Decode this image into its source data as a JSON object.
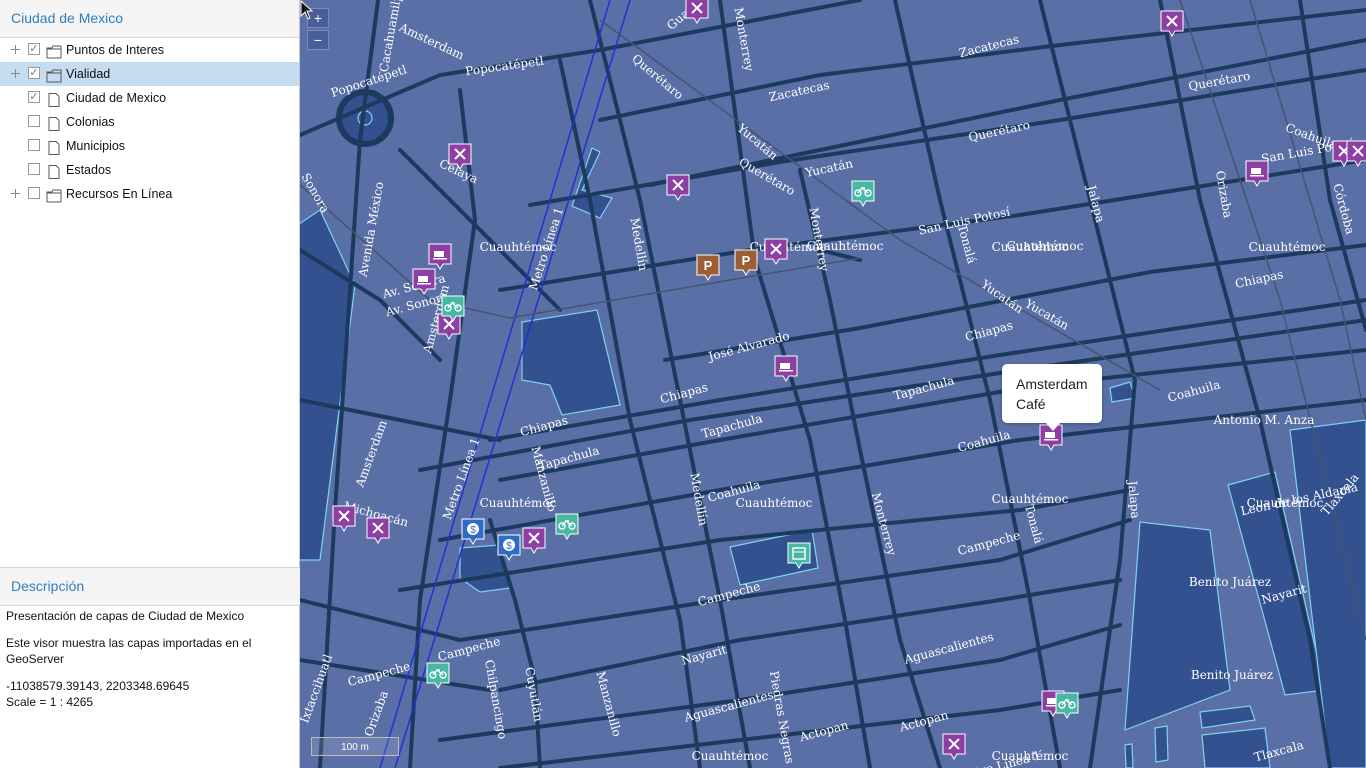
{
  "sidebar": {
    "title": "Ciudad de Mexico",
    "layers": [
      {
        "label": "Puntos de Interes",
        "type": "folder",
        "checked": true,
        "expandable": true,
        "selected": false
      },
      {
        "label": "Vialidad",
        "type": "folder",
        "checked": true,
        "expandable": true,
        "selected": true
      },
      {
        "label": "Ciudad de Mexico",
        "type": "file",
        "checked": true,
        "expandable": false,
        "selected": false
      },
      {
        "label": "Colonias",
        "type": "file",
        "checked": false,
        "expandable": false,
        "selected": false
      },
      {
        "label": "Municipios",
        "type": "file",
        "checked": false,
        "expandable": false,
        "selected": false
      },
      {
        "label": "Estados",
        "type": "file",
        "checked": false,
        "expandable": false,
        "selected": false
      },
      {
        "label": "Recursos En Línea",
        "type": "folder",
        "checked": false,
        "expandable": true,
        "selected": false
      }
    ]
  },
  "description": {
    "title": "Descripción",
    "line1": "Presentación de capas de Ciudad de Mexico",
    "line2": "Este visor muestra las capas importadas en el GeoServer",
    "coordinates": "-11038579.39143, 2203348.69645",
    "scale": "Scale = 1 : 4265"
  },
  "map": {
    "zoom_in": "+",
    "zoom_out": "−",
    "scalebar": "100 m",
    "popup": {
      "line1": "Amsterdam",
      "line2": "Café"
    },
    "colors": {
      "background": "#5a6fa6",
      "block": "#33508f",
      "block_outline": "#7fd3f0",
      "street": "#1c3a5e",
      "restaurant_marker": "#8e3fa3",
      "cafe_marker": "#8e3fa3",
      "bike_marker": "#46b8a3",
      "parking_marker": "#9c5e35",
      "bank_marker": "#2e6bc4",
      "cinema_marker": "#46b8a3"
    },
    "street_labels": [
      "Guanajuato",
      "Amsterdam",
      "Cacahuamilpa",
      "Popocatépetl",
      "Popocatépetl",
      "Monterrey",
      "Zacatecas",
      "Zacatecas",
      "Querétaro",
      "Yucatán",
      "Yucatán",
      "Querétaro",
      "Querétaro",
      "Querétaro",
      "Celaya",
      "Sonora",
      "Avenida México",
      "Metro Línea 1",
      "Medellín",
      "Monterrey",
      "San Luis Potosí",
      "San Luis Potosí",
      "Tonalá",
      "Jalapa",
      "Orizaba",
      "Córdoba",
      "Chiapas",
      "Chiapas",
      "Chiapas",
      "Chiapas",
      "Yucatán",
      "Yucatán",
      "Av. Sonora",
      "Av. Sonora",
      "Amsterdam",
      "José Alvarado",
      "Tapachula",
      "Tapachula",
      "Tapachula",
      "Coahuila",
      "Coahuila",
      "Coahuila",
      "Antonio M. Anza",
      "Amsterdam",
      "Michoacán",
      "Metro Línea 1",
      "Manzanillo",
      "Medellín",
      "Monterrey",
      "Leon de los Aldama",
      "Tonalá",
      "Jalapa",
      "Campeche",
      "Campeche",
      "Campeche",
      "Campeche",
      "Nayarit",
      "Nayarit",
      "Aguascalientes",
      "Aguascalientes",
      "Ixtaccihuatl",
      "Chilpancingo",
      "Cuyutlán",
      "Manzanillo",
      "Piedras Negras",
      "Actopan",
      "Actopan",
      "Tlaxcala",
      "Tlaxcala",
      "Metro Línea 1",
      "Orizaba",
      "Coahuila"
    ],
    "area_labels": [
      "Cuauhtémoc",
      "Cuauhtémoc",
      "Cuauhtémoc",
      "Cuauhtémoc",
      "Cuauhtémoc",
      "Cuauhtémoc",
      "Cuauhtémoc",
      "Cuauhtémoc",
      "Benito Juárez",
      "Benito Juárez",
      "Cuauhtémoc",
      "Cuauhtémoc",
      "Cuauhtémoc",
      "Cuauhtémoc"
    ],
    "marker_glyphs": {
      "bank": "$",
      "parking": "P"
    }
  }
}
